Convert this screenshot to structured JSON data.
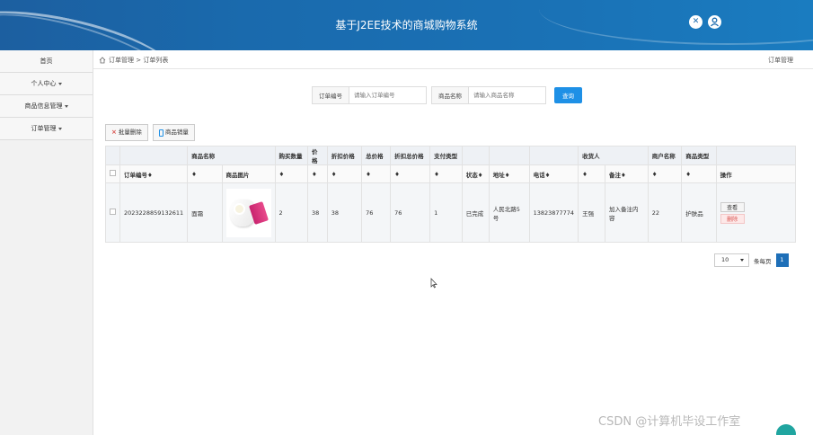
{
  "header": {
    "title": "基于J2EE技术的商城购物系统",
    "icons": [
      "settings-icon",
      "user-icon"
    ]
  },
  "sidebar": {
    "items": [
      {
        "label": "首页",
        "dropdown": false
      },
      {
        "label": "个人中心",
        "dropdown": true
      },
      {
        "label": "商品信息管理",
        "dropdown": true
      },
      {
        "label": "订单管理",
        "dropdown": true
      }
    ]
  },
  "breadcrumb": {
    "path": "订单管理 > 订单列表",
    "right": "订单管理"
  },
  "search": {
    "order_label": "订单编号",
    "order_placeholder": "请输入订单编号",
    "product_label": "商品名称",
    "product_placeholder": "请输入商品名称",
    "button": "查询"
  },
  "actions": {
    "batch_delete": "批量删除",
    "sales": "商品销量"
  },
  "table": {
    "group_headers": [
      "商品名称",
      "购买数量",
      "价格",
      "折扣价格",
      "总价格",
      "折扣总价格",
      "支付类型",
      "收货人",
      "商户名称",
      "商品类型"
    ],
    "columns": [
      "订单编号",
      "商品图片",
      "状态",
      "地址",
      "电话",
      "备注",
      "操作"
    ],
    "sort_mark": "♦",
    "rows": [
      {
        "order_no": "2023228859132611",
        "product_name": "面霜",
        "quantity": "2",
        "price": "38",
        "discount_price": "38",
        "total": "76",
        "discount_total": "76",
        "pay_type": "1",
        "status": "已完成",
        "address": "人民北路5号",
        "phone": "13823877774",
        "receiver": "王强",
        "note": "加入备注内容",
        "merchant": "22",
        "category": "护肤品",
        "op_view": "查看",
        "op_delete": "删除"
      }
    ]
  },
  "pagination": {
    "page_size": "10",
    "per_page_label": "条每页",
    "current_page": "1"
  },
  "watermark": "CSDN @计算机毕设工作室",
  "colors": {
    "header": "#1a6aad",
    "primary": "#1e90e6",
    "danger": "#d9534f"
  }
}
